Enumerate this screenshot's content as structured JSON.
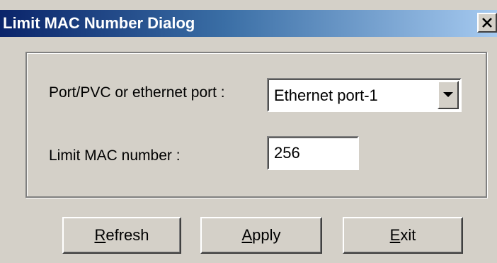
{
  "window": {
    "title": "Limit MAC Number Dialog",
    "close_glyph": "×",
    "close_icon": "close-icon"
  },
  "form": {
    "port_label": "Port/PVC or ethernet port :",
    "port_value": "Ethernet port-1",
    "dropdown_icon": "chevron-down-icon",
    "limit_label": "Limit MAC number :",
    "limit_value": "256"
  },
  "buttons": {
    "refresh": {
      "mnemonic": "R",
      "rest": "efresh"
    },
    "apply": {
      "mnemonic": "A",
      "rest": "pply"
    },
    "exit": {
      "mnemonic": "E",
      "rest": "xit"
    }
  },
  "colors": {
    "dialog_bg": "#d4d0c8",
    "title_start": "#0a246a",
    "title_end": "#a6caf0",
    "title_text": "#ffffff"
  }
}
